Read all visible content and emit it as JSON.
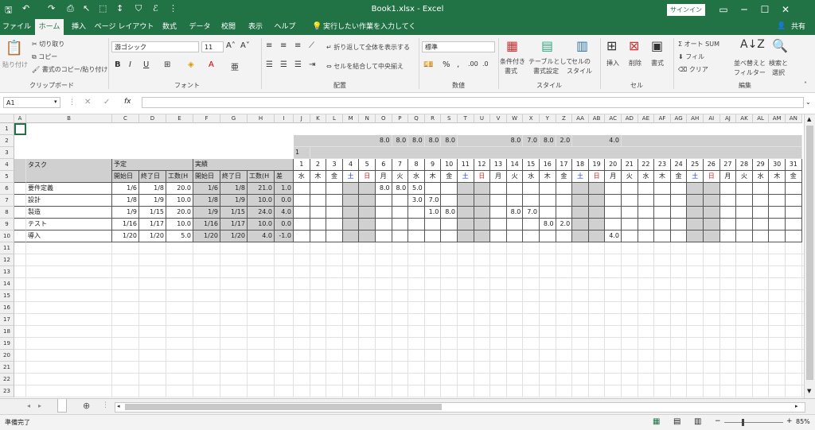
{
  "titlebar": {
    "title": "Book1.xlsx  -  Excel",
    "signin": "サインイン",
    "share": "共有"
  },
  "menu": {
    "tabs": [
      "ファイル",
      "ホーム",
      "挿入",
      "ページ レイアウト",
      "数式",
      "データ",
      "校閲",
      "表示",
      "ヘルプ"
    ],
    "tellme": "実行したい作業を入力してください"
  },
  "ribbon": {
    "paste": "貼り付け",
    "cut": "切り取り",
    "copy": "コピー",
    "format_painter": "書式のコピー/貼り付け",
    "clipboard_title": "クリップボード",
    "font_name": "游ゴシック",
    "font_size": "11",
    "font_title": "フォント",
    "wrap_text": "折り返して全体を表示する",
    "merge_center": "セルを結合して中央揃え",
    "alignment_title": "配置",
    "number_format": "標準",
    "number_title": "数値",
    "cond_format": "条件付き",
    "cond_format2": "書式",
    "table_format": "テーブルとして",
    "table_format2": "書式設定",
    "cell_style": "セルの",
    "cell_style2": "スタイル",
    "style_title": "スタイル",
    "insert": "挿入",
    "delete": "削除",
    "format": "書式",
    "cells_title": "セル",
    "autosum": "オート SUM",
    "fill": "フィル",
    "clear": "クリア",
    "sort_filter": "並べ替えと",
    "sort_filter2": "フィルター",
    "find_select": "検索と",
    "find_select2": "選択",
    "edit_title": "編集"
  },
  "formula": {
    "namebox": "A1",
    "fx": "fx",
    "value": ""
  },
  "columns": [
    "A",
    "B",
    "C",
    "D",
    "E",
    "F",
    "G",
    "H",
    "I",
    "J",
    "K",
    "L",
    "M",
    "N",
    "O",
    "P",
    "Q",
    "R",
    "S",
    "T",
    "U",
    "V",
    "W",
    "X",
    "Y",
    "Z",
    "AA",
    "AB",
    "AC",
    "AD",
    "AE",
    "AF",
    "AG",
    "AH",
    "AI",
    "AJ",
    "AK",
    "AL",
    "AM",
    "AN"
  ],
  "rows": [
    "1",
    "2",
    "3",
    "4",
    "5",
    "6",
    "7",
    "8",
    "9",
    "10",
    "11",
    "12",
    "13",
    "14",
    "15",
    "16",
    "17",
    "18",
    "19",
    "20",
    "21",
    "22",
    "23"
  ],
  "sheet": {
    "row2_daily": {
      "O": "8.0",
      "P": "8.0",
      "Q": "8.0",
      "R": "8.0",
      "S": "8.0",
      "W": "8.0",
      "X": "7.0",
      "Y": "8.0",
      "Z": "2.0",
      "AC": "4.0"
    },
    "month": "1",
    "header": {
      "task": "タスク",
      "plan": "予定",
      "actual": "実績",
      "start": "開始日",
      "end": "終了日",
      "hours": "工数(H",
      "diff": "差"
    },
    "days": [
      "1",
      "2",
      "3",
      "4",
      "5",
      "6",
      "7",
      "8",
      "9",
      "10",
      "11",
      "12",
      "13",
      "14",
      "15",
      "16",
      "17",
      "18",
      "19",
      "20",
      "21",
      "22",
      "23",
      "24",
      "25",
      "26",
      "27",
      "28",
      "29",
      "30",
      "31"
    ],
    "weekdays": [
      "水",
      "木",
      "金",
      "土",
      "日",
      "月",
      "火",
      "水",
      "木",
      "金",
      "土",
      "日",
      "月",
      "火",
      "水",
      "木",
      "金",
      "土",
      "日",
      "月",
      "火",
      "水",
      "木",
      "金",
      "土",
      "日",
      "月",
      "火",
      "水",
      "木",
      "金"
    ],
    "tasks": [
      {
        "name": "要件定義",
        "ps": "1/6",
        "pe": "1/8",
        "ph": "20.0",
        "as": "1/6",
        "ae": "1/8",
        "ah": "21.0",
        "d": "1.0",
        "hours": {
          "6": "8.0",
          "7": "8.0",
          "8": "5.0"
        }
      },
      {
        "name": "設計",
        "ps": "1/8",
        "pe": "1/9",
        "ph": "10.0",
        "as": "1/8",
        "ae": "1/9",
        "ah": "10.0",
        "d": "0.0",
        "hours": {
          "8": "3.0",
          "9": "7.0"
        }
      },
      {
        "name": "製造",
        "ps": "1/9",
        "pe": "1/15",
        "ph": "20.0",
        "as": "1/9",
        "ae": "1/15",
        "ah": "24.0",
        "d": "4.0",
        "hours": {
          "9": "1.0",
          "10": "8.0",
          "14": "8.0",
          "15": "7.0"
        }
      },
      {
        "name": "テスト",
        "ps": "1/16",
        "pe": "1/17",
        "ph": "10.0",
        "as": "1/16",
        "ae": "1/17",
        "ah": "10.0",
        "d": "0.0",
        "hours": {
          "16": "8.0",
          "17": "2.0"
        }
      },
      {
        "name": "導入",
        "ps": "1/20",
        "pe": "1/20",
        "ph": "5.0",
        "as": "1/20",
        "ae": "1/20",
        "ah": "4.0",
        "d": "-1.0",
        "hours": {
          "20": "4.0"
        }
      }
    ]
  },
  "statusbar": {
    "ready": "準備完了",
    "zoom": "85%"
  },
  "colors": {
    "excel_green": "#217346",
    "weekend_gray": "#d0d0d0",
    "saturday": "#1f3bd6",
    "sunday": "#d62020"
  }
}
